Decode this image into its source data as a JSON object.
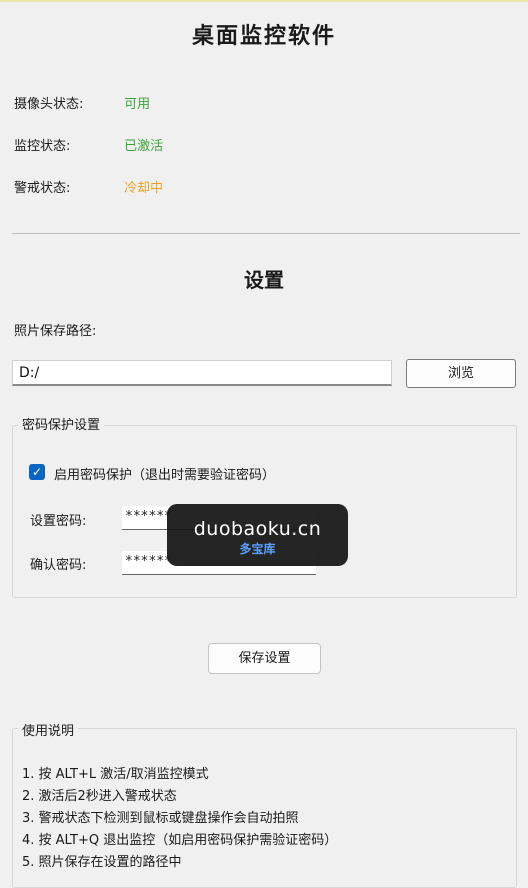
{
  "window": {
    "title": "桌面监控软件"
  },
  "status": [
    {
      "label": "摄像头状态:",
      "value": "可用",
      "color": "#3aa53a"
    },
    {
      "label": "监控状态:",
      "value": "已激活",
      "color": "#3aa53a"
    },
    {
      "label": "警戒状态:",
      "value": "冷却中",
      "color": "#f0a020"
    }
  ],
  "settings": {
    "heading": "设置",
    "path_label": "照片保存路径:",
    "path_value": "D:/",
    "browse_label": "浏览",
    "password_group": {
      "title": "密码保护设置",
      "enable_label": "启用密码保护（退出时需要验证密码）",
      "enabled": true,
      "set_label": "设置密码:",
      "set_value": "******",
      "confirm_label": "确认密码:",
      "confirm_value": "******"
    },
    "save_label": "保存设置"
  },
  "usage": {
    "title": "使用说明",
    "lines": [
      "1. 按 ALT+L 激活/取消监控模式",
      "2. 激活后2秒进入警戒状态",
      "3. 警戒状态下检测到鼠标或键盘操作会自动拍照",
      "4. 按 ALT+Q 退出监控（如启用密码保护需验证密码）",
      "5. 照片保存在设置的路径中"
    ]
  },
  "watermark": {
    "line1": "duobaoku.cn",
    "line2": "多宝库"
  }
}
